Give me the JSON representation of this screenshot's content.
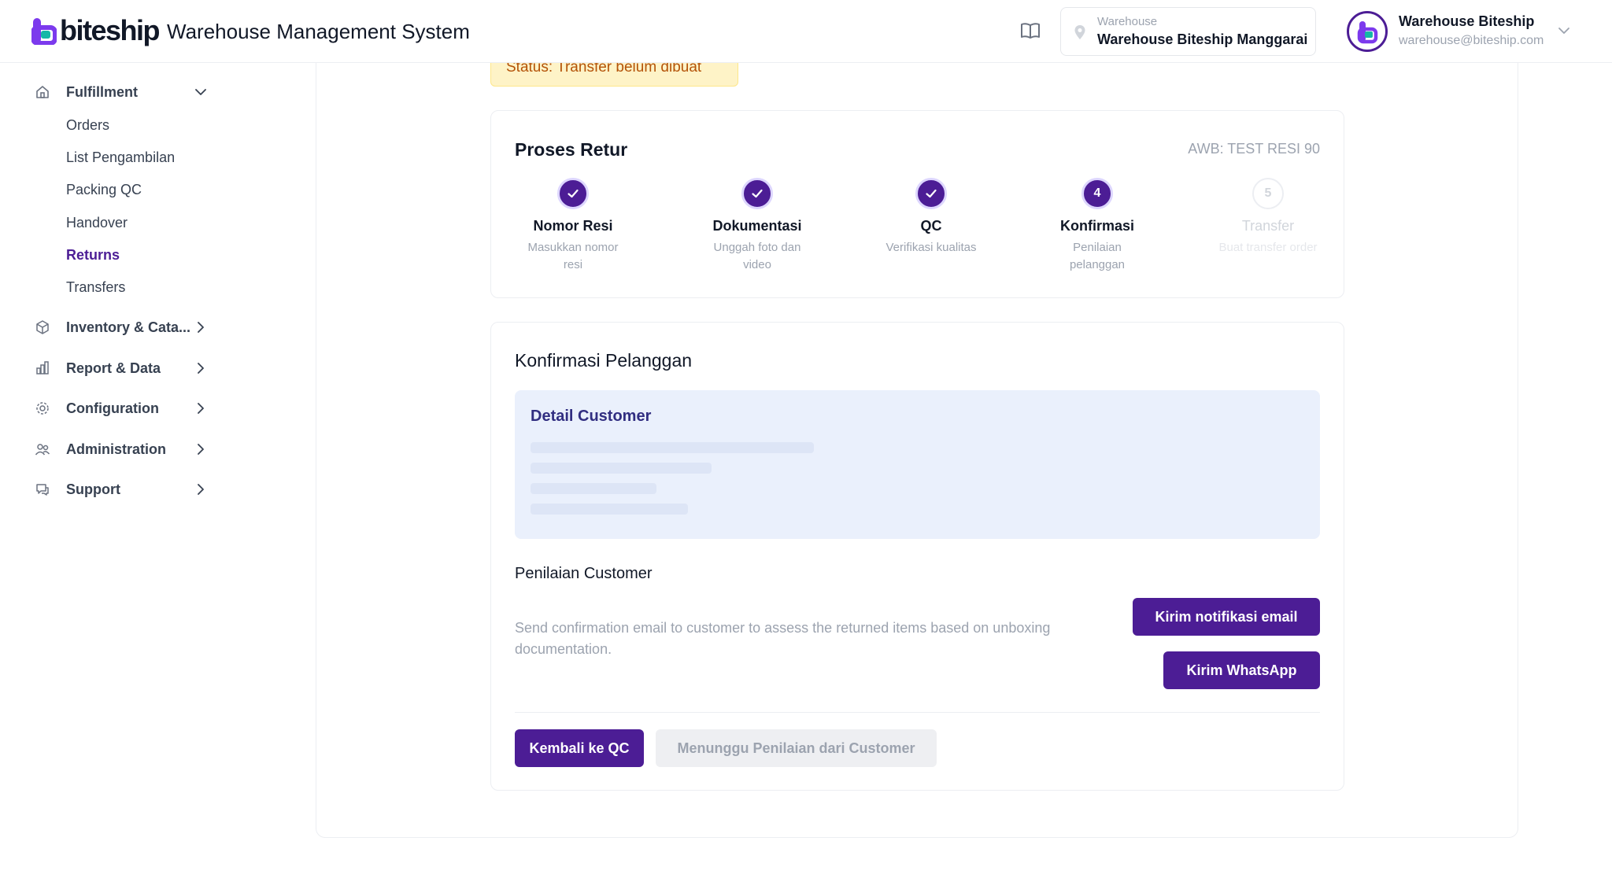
{
  "header": {
    "logo_text": "biteship",
    "app_title": "Warehouse Management System",
    "warehouse_label": "Warehouse",
    "warehouse_name": "Warehouse Biteship Manggarai",
    "user_name": "Warehouse Biteship",
    "user_email": "warehouse@biteship.com"
  },
  "sidebar": {
    "fulfillment": {
      "label": "Fulfillment",
      "items": [
        {
          "label": "Orders"
        },
        {
          "label": "List Pengambilan"
        },
        {
          "label": "Packing QC"
        },
        {
          "label": "Handover"
        },
        {
          "label": "Returns",
          "active": true
        },
        {
          "label": "Transfers"
        }
      ]
    },
    "groups": [
      {
        "label": "Inventory & Cata...",
        "icon": "box-icon"
      },
      {
        "label": "Report & Data",
        "icon": "bar-chart-icon"
      },
      {
        "label": "Configuration",
        "icon": "gear-icon"
      },
      {
        "label": "Administration",
        "icon": "users-icon"
      },
      {
        "label": "Support",
        "icon": "chat-icon"
      }
    ]
  },
  "status": {
    "text": "Status:  Transfer belum dibuat"
  },
  "proses_retur": {
    "title": "Proses Retur",
    "awb": "AWB: TEST RESI 90",
    "steps": [
      {
        "title": "Nomor Resi",
        "subtitle": "Masukkan nomor resi",
        "state": "done"
      },
      {
        "title": "Dokumentasi",
        "subtitle": "Unggah foto dan video",
        "state": "done"
      },
      {
        "title": "QC",
        "subtitle": "Verifikasi kualitas",
        "state": "done"
      },
      {
        "title": "Konfirmasi",
        "subtitle": "Penilaian pelanggan",
        "number": "4",
        "state": "current"
      },
      {
        "title": "Transfer",
        "subtitle": "Buat transfer order",
        "number": "5",
        "state": "pending"
      }
    ]
  },
  "konfirmasi": {
    "title": "Konfirmasi Pelanggan",
    "detail_title": "Detail Customer",
    "penilaian_title": "Penilaian Customer",
    "description": "Send confirmation email to customer to assess the returned items based on unboxing documentation.",
    "email_button": "Kirim notifikasi email",
    "whatsapp_button": "Kirim WhatsApp",
    "back_button": "Kembali ke QC",
    "waiting_button": "Menunggu Penilaian dari Customer"
  },
  "colors": {
    "primary": "#4c1d95",
    "status_bg": "#fef3c7",
    "status_text": "#b45309",
    "detail_bg": "#eaf0fc"
  }
}
